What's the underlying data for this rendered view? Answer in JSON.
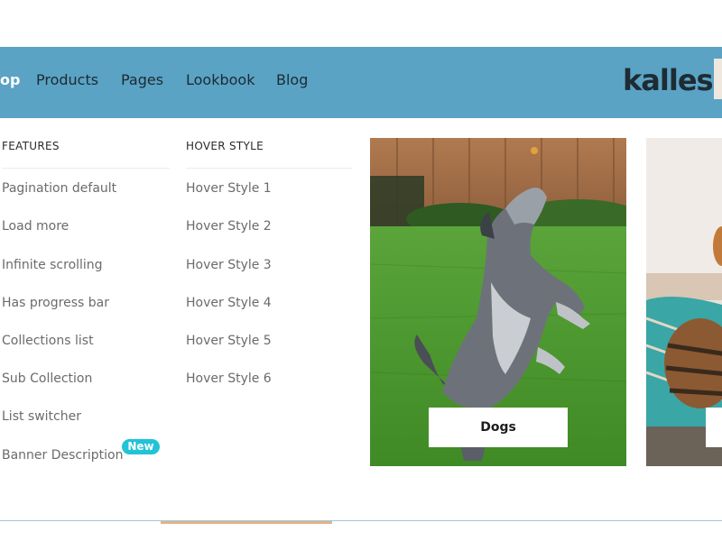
{
  "header": {
    "nav": [
      {
        "label": "op",
        "active": true
      },
      {
        "label": "Products",
        "active": false
      },
      {
        "label": "Pages",
        "active": false
      },
      {
        "label": "Lookbook",
        "active": false
      },
      {
        "label": "Blog",
        "active": false
      }
    ],
    "logo_text": "kalles",
    "background_color": "#5aa3c4"
  },
  "mega_menu": {
    "features": {
      "heading": "FEATURES",
      "items": [
        "Pagination default",
        "Load more",
        "Infinite scrolling",
        "Has progress bar",
        "Collections list",
        "Sub Collection",
        "List switcher",
        "Banner Description"
      ],
      "badge": "New"
    },
    "hover_style": {
      "heading": "HOVER STYLE",
      "items": [
        "Hover Style 1",
        "Hover Style 2",
        "Hover Style 3",
        "Hover Style 4",
        "Hover Style 5",
        "Hover Style 6"
      ]
    },
    "cards": [
      {
        "label": "Dogs",
        "image": "dog-jumping-on-lawn"
      },
      {
        "label": "",
        "image": "cat-on-blanket"
      }
    ]
  },
  "colors": {
    "badge": "#22c3d6",
    "nav_text": "#1d2a33",
    "menu_text": "#6b6b6b"
  }
}
